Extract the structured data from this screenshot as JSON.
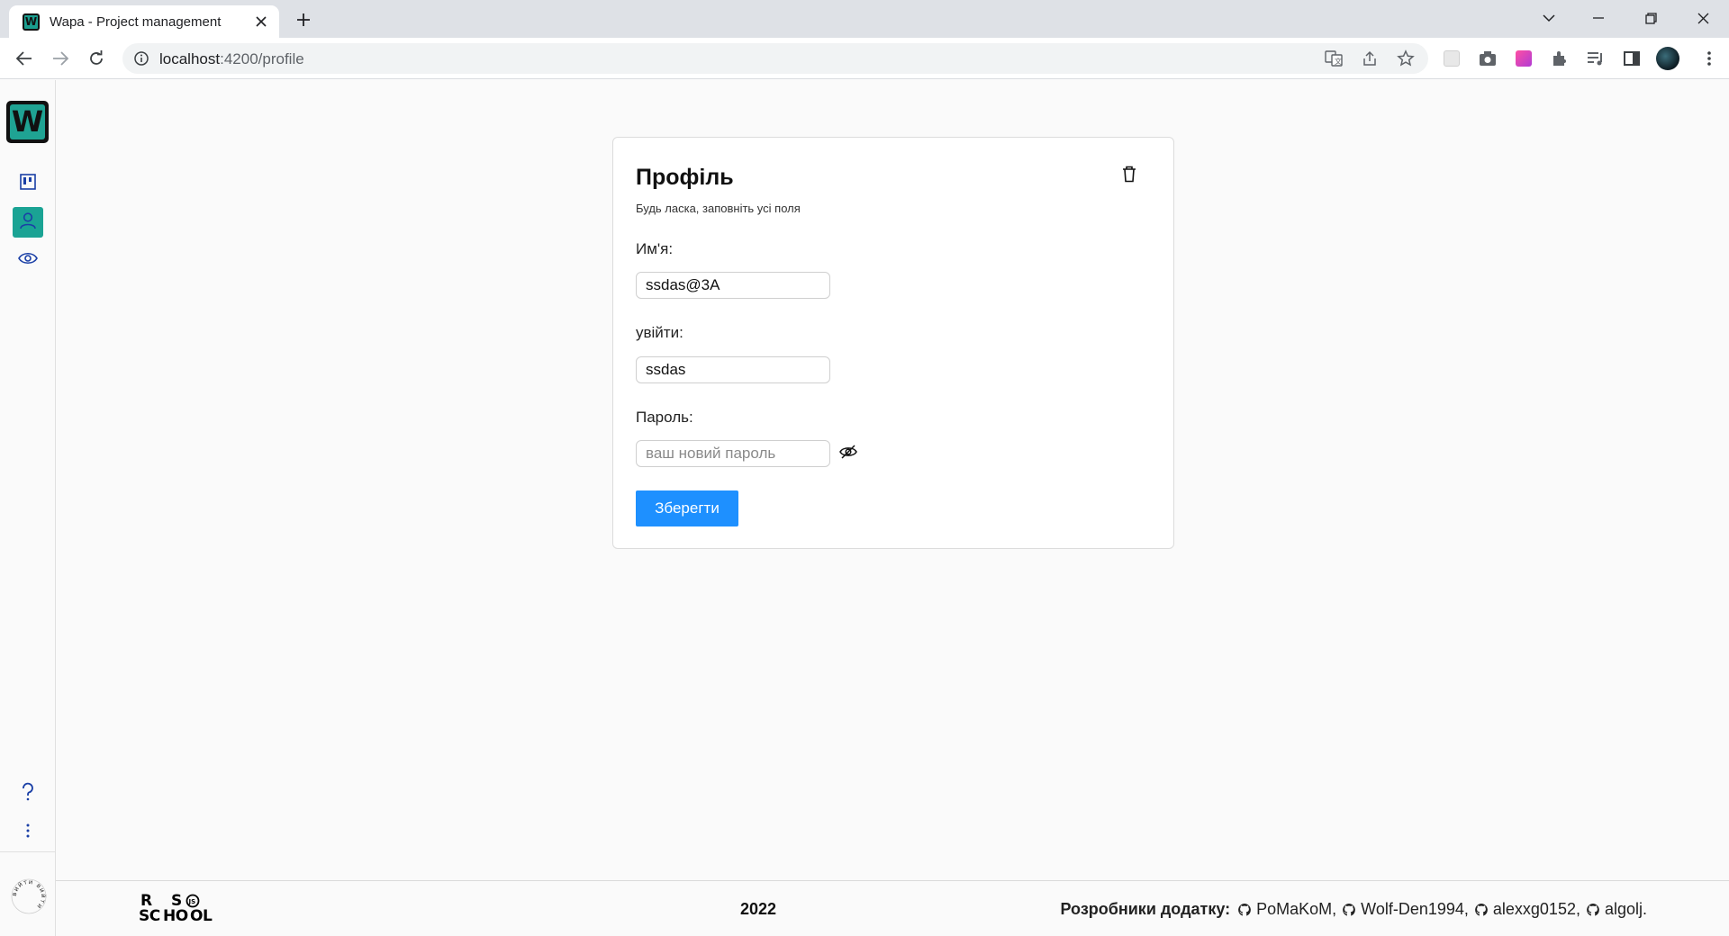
{
  "browser": {
    "tab_title": "Wapa - Project management",
    "favicon_letter": "W",
    "url_host": "localhost",
    "url_rest": ":4200/profile"
  },
  "sidebar": {
    "logo_letter": "W",
    "items": [
      {
        "name": "boards",
        "icon": "kanban-board-icon"
      },
      {
        "name": "profile",
        "icon": "user-icon",
        "active": true
      },
      {
        "name": "view",
        "icon": "eye-icon"
      }
    ],
    "bottom": [
      {
        "name": "help",
        "icon": "question-icon"
      },
      {
        "name": "more",
        "icon": "more-vertical-icon"
      }
    ],
    "logout_badge_text": "вийти вийти"
  },
  "profile": {
    "title": "Профіль",
    "subtitle": "Будь ласка, заповніть усі поля",
    "name_label": "Им'я:",
    "name_value": "ssdas@3A",
    "login_label": "увійти:",
    "login_value": "ssdas",
    "password_label": "Пароль:",
    "password_value": "",
    "password_placeholder": "ваш новий пароль",
    "save_label": "Зберегти"
  },
  "footer": {
    "logo_letters": [
      "R",
      "S",
      "SC",
      "HO",
      "OL"
    ],
    "year": "2022",
    "developers_label": "Розробники додатку:",
    "developers": [
      "PoMaKoM,",
      "Wolf-Den1994,",
      "alexxg0152,",
      "algolj."
    ]
  },
  "colors": {
    "accent": "#1aa394",
    "primary_button": "#1e90ff",
    "sidebar_icon": "#1a3fa6"
  }
}
